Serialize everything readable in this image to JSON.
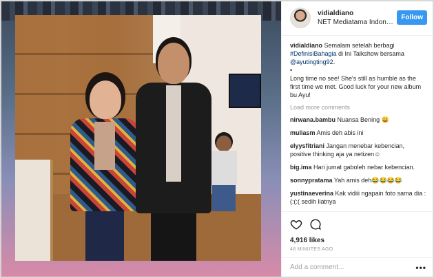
{
  "post": {
    "username": "vidialdiano",
    "location": "NET Mediatama Indonesia",
    "follow_label": "Follow",
    "caption": {
      "user": "vidialdiano",
      "text_1": " Semalam setelah berbagi ",
      "hashtag": "#DefinisiBahagia",
      "text_2": " di Ini Talkshow bersama ",
      "mention": "@ayutingting92",
      "text_3": ".",
      "bullet": "•",
      "extra": "Long time no see! She's still as humble as the first time we met. Good luck for your new album bu Ayu!"
    },
    "load_more": "Load more comments",
    "comments": [
      {
        "user": "nirwana.bambu",
        "text": "Nuansa Bening 😄"
      },
      {
        "user": "muliasm",
        "text": "Amis deh abis ini"
      },
      {
        "user": "elyysfitriani",
        "text": "Jangan menebar kebencian, positive thinking aja ya netizen☺"
      },
      {
        "user": "big.ima",
        "text": "Hari jumat gaboleh nebar kebencian."
      },
      {
        "user": "sonnypratama",
        "text": "Yah amis deh😂😂😂😂"
      },
      {
        "user": "yustinaeverina",
        "text": "Kak vidiii ngapain foto sama dia :(:(:( sedih liatnya"
      }
    ],
    "likes": "4,916 likes",
    "time": "48 MINUTES AGO",
    "add_comment_placeholder": "Add a comment...",
    "more_label": "•••"
  },
  "icons": {
    "like": "heart-icon",
    "comment": "comment-bubble-icon",
    "more": "more-options-icon"
  },
  "colors": {
    "follow_bg": "#3897f0",
    "link": "#003569",
    "muted": "#999999"
  }
}
